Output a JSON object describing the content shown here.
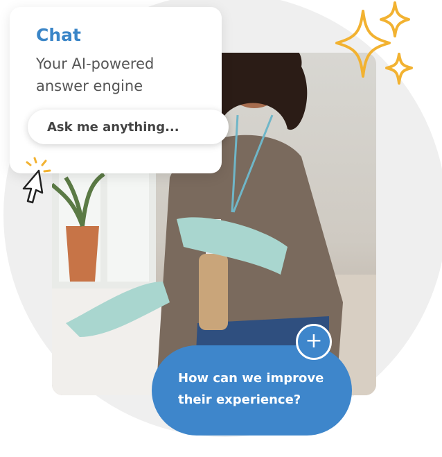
{
  "chat_card": {
    "title": "Chat",
    "subtitle": "Your AI-powered answer engine",
    "input_placeholder": "Ask me anything..."
  },
  "improve_bubble": {
    "text": "How can we improve their experience?",
    "plus_label": "+"
  },
  "icons": {
    "cursor": "cursor-click-icon",
    "sparkles": "sparkles-icon"
  },
  "colors": {
    "accent_blue": "#3a85c7",
    "bubble_blue": "#3e86cb",
    "sparkle_yellow": "#f2b231"
  }
}
